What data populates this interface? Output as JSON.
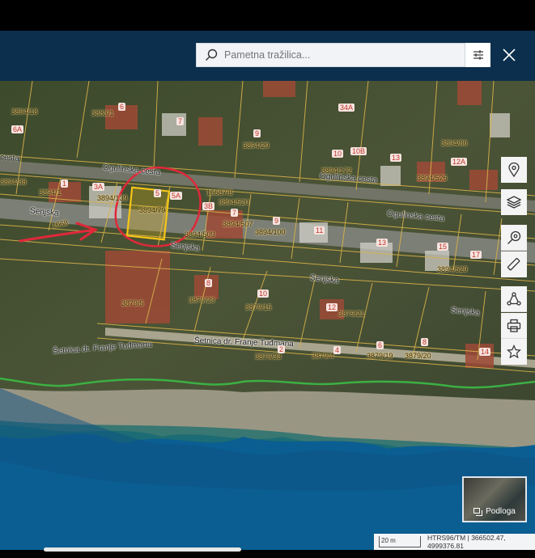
{
  "header": {
    "search_placeholder": "Pametna tražilica...",
    "filter_icon": "sliders-icon",
    "close_icon": "close-icon"
  },
  "map": {
    "streets": [
      "Ogulinska cesta",
      "Ogulinska cesta",
      "Ogulinska cesta",
      "Senjska",
      "Senjska",
      "Senjska",
      "Senjska",
      "Šetnica dr. Franje Tuđmana",
      "Šetnica dr. Franje Tuđmana",
      "cesta"
    ],
    "parcels": [
      "3894/18",
      "3883/1",
      "3894/38",
      "3894/1",
      "3894/139",
      "3894/79",
      "3894/520",
      "3894/507",
      "3894/509",
      "3894/100",
      "3894/29",
      "3894/172",
      "3894/526",
      "3894/529",
      "3879/21",
      "3879/15",
      "3879/33",
      "3879/23",
      "3879/4",
      "3879/19",
      "3879/20",
      "3879/5",
      "3894/86",
      "16687/8",
      "1668"
    ],
    "house_numbers": [
      "6A",
      "6",
      "7",
      "9",
      "10",
      "10B",
      "13",
      "12A",
      "1",
      "3A",
      "5",
      "5A",
      "3B",
      "7",
      "9",
      "11",
      "13",
      "15",
      "17",
      "8",
      "10",
      "12",
      "2",
      "4",
      "6",
      "8",
      "14",
      "34A"
    ],
    "highlight_color": "#f5c518",
    "annotation_color": "#e0283a",
    "coastline_color": "#3cb043"
  },
  "tools": [
    "location-pin-icon",
    "layers-icon",
    "search-location-icon",
    "ruler-icon",
    "share-icon",
    "print-icon",
    "star-icon"
  ],
  "basemap": {
    "label": "Podloga"
  },
  "status": {
    "scale": "20 m",
    "coordinates": "HTRS96/TM | 366502.47, 4999376.81"
  }
}
